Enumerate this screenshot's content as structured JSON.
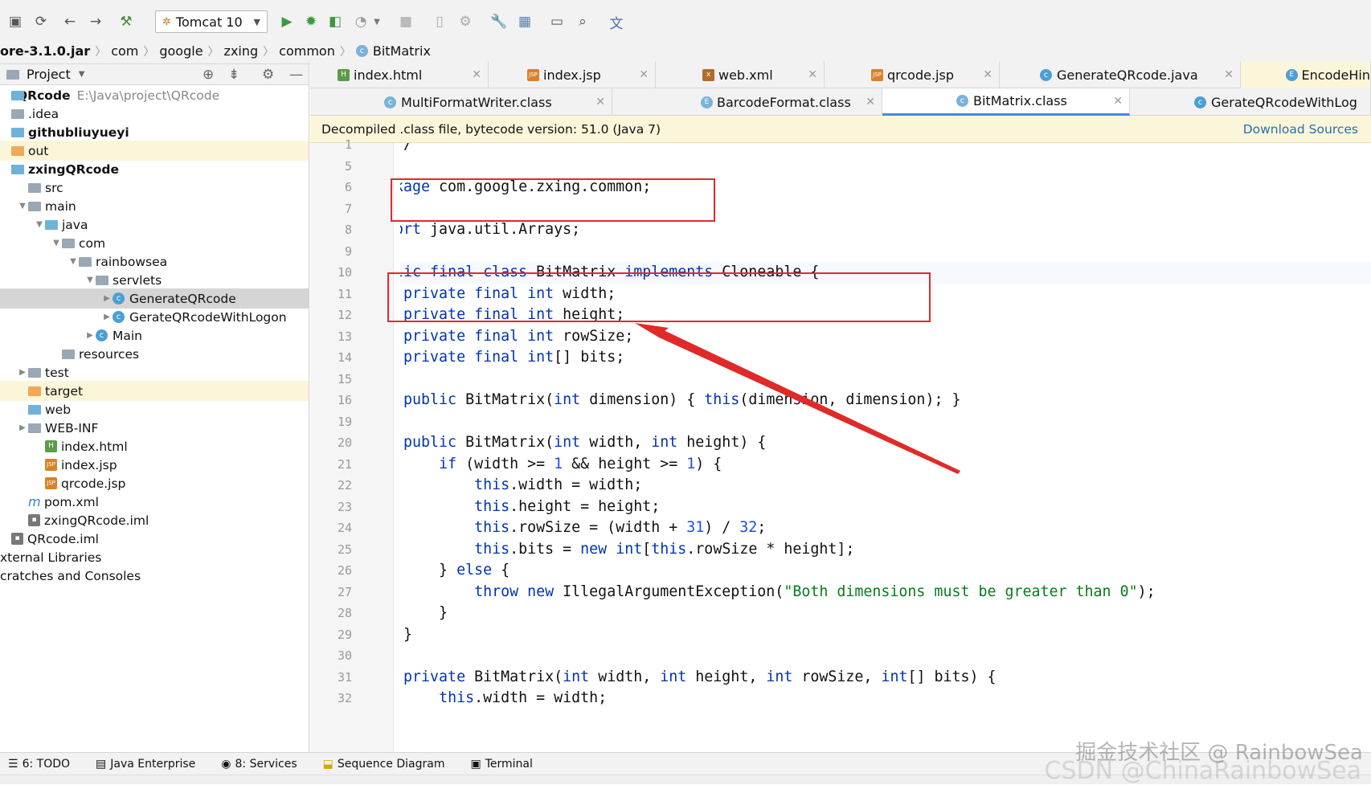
{
  "toolbar": {
    "run_config": "Tomcat 10",
    "icons": [
      "save-icon",
      "sync-icon",
      "back-icon",
      "forward-icon",
      "build-icon",
      "run-icon",
      "debug-icon",
      "coverage-icon",
      "profile-icon",
      "stop-icon",
      "attach-icon",
      "device-icon",
      "wrench-icon",
      "project-structure-icon",
      "terminal-icon",
      "search-icon",
      "translate-icon"
    ]
  },
  "breadcrumb": [
    "ore-3.1.0.jar",
    "com",
    "google",
    "zxing",
    "common",
    "BitMatrix"
  ],
  "project": {
    "header": "Project",
    "tree": [
      {
        "label": "QRcode",
        "extra": "E:\\Java\\project\\QRcode",
        "indent": 0,
        "bold": true,
        "type": "root"
      },
      {
        "label": ".idea",
        "indent": 0,
        "type": "folder"
      },
      {
        "label": "githubliuyueyi",
        "indent": 0,
        "bold": true,
        "type": "module"
      },
      {
        "label": "out",
        "indent": 0,
        "type": "folder-orange",
        "highlight": true
      },
      {
        "label": "zxingQRcode",
        "indent": 0,
        "bold": true,
        "type": "module"
      },
      {
        "label": "src",
        "indent": 1,
        "type": "folder"
      },
      {
        "label": "main",
        "indent": 1,
        "type": "folder",
        "arrow": "down"
      },
      {
        "label": "java",
        "indent": 2,
        "type": "folder-blue",
        "arrow": "down"
      },
      {
        "label": "com",
        "indent": 3,
        "type": "folder",
        "arrow": "down"
      },
      {
        "label": "rainbowsea",
        "indent": 4,
        "type": "folder",
        "arrow": "down"
      },
      {
        "label": "servlets",
        "indent": 5,
        "type": "folder",
        "arrow": "down"
      },
      {
        "label": "GenerateQRcode",
        "indent": 6,
        "type": "class",
        "arrow": "right",
        "selected": true
      },
      {
        "label": "GerateQRcodeWithLogon",
        "indent": 6,
        "type": "class",
        "arrow": "right"
      },
      {
        "label": "Main",
        "indent": 5,
        "type": "class",
        "arrow": "right"
      },
      {
        "label": "resources",
        "indent": 3,
        "type": "folder"
      },
      {
        "label": "test",
        "indent": 1,
        "type": "folder",
        "arrow": "right"
      },
      {
        "label": "target",
        "indent": 1,
        "type": "folder-orange",
        "highlight": true
      },
      {
        "label": "web",
        "indent": 1,
        "type": "folder-blue"
      },
      {
        "label": "WEB-INF",
        "indent": 1,
        "type": "folder",
        "arrow": "right"
      },
      {
        "label": "index.html",
        "indent": 2,
        "type": "html"
      },
      {
        "label": "index.jsp",
        "indent": 2,
        "type": "jsp"
      },
      {
        "label": "qrcode.jsp",
        "indent": 2,
        "type": "jsp"
      },
      {
        "label": "pom.xml",
        "indent": 1,
        "type": "maven"
      },
      {
        "label": "zxingQRcode.iml",
        "indent": 1,
        "type": "iml"
      },
      {
        "label": "QRcode.iml",
        "indent": 0,
        "type": "iml"
      },
      {
        "label": "xternal Libraries",
        "indent": 0,
        "type": "none"
      },
      {
        "label": "cratches and Consoles",
        "indent": 0,
        "type": "none"
      }
    ]
  },
  "tabs_row1": [
    "index.html",
    "index.jsp",
    "web.xml",
    "qrcode.jsp",
    "GenerateQRcode.java",
    "EncodeHin"
  ],
  "tabs_row2": [
    "MultiFormatWriter.class",
    "BarcodeFormat.class",
    "BitMatrix.class",
    "GerateQRcodeWithLog"
  ],
  "active_tab": "BitMatrix.class",
  "banner": {
    "text": "Decompiled .class file, bytecode version: 51.0 (Java 7)",
    "action": "Download Sources"
  },
  "code_lines": [
    {
      "n": "1",
      "t": "/.../"
    },
    {
      "n": "5",
      "t": ""
    },
    {
      "n": "6",
      "t": "package com.google.zxing.common;"
    },
    {
      "n": "7",
      "t": ""
    },
    {
      "n": "8",
      "t": "import java.util.Arrays;"
    },
    {
      "n": "9",
      "t": ""
    },
    {
      "n": "10",
      "t": "public final class BitMatrix implements Cloneable {"
    },
    {
      "n": "11",
      "t": "    private final int width;"
    },
    {
      "n": "12",
      "t": "    private final int height;"
    },
    {
      "n": "13",
      "t": "    private final int rowSize;"
    },
    {
      "n": "14",
      "t": "    private final int[] bits;"
    },
    {
      "n": "15",
      "t": ""
    },
    {
      "n": "16",
      "t": "    public BitMatrix(int dimension) { this(dimension, dimension); }"
    },
    {
      "n": "19",
      "t": ""
    },
    {
      "n": "20",
      "t": "    public BitMatrix(int width, int height) {"
    },
    {
      "n": "21",
      "t": "        if (width >= 1 && height >= 1) {"
    },
    {
      "n": "22",
      "t": "            this.width = width;"
    },
    {
      "n": "23",
      "t": "            this.height = height;"
    },
    {
      "n": "24",
      "t": "            this.rowSize = (width + 31) / 32;"
    },
    {
      "n": "25",
      "t": "            this.bits = new int[this.rowSize * height];"
    },
    {
      "n": "26",
      "t": "        } else {"
    },
    {
      "n": "27",
      "t": "            throw new IllegalArgumentException(\"Both dimensions must be greater than 0\");"
    },
    {
      "n": "28",
      "t": "        }"
    },
    {
      "n": "29",
      "t": "    }"
    },
    {
      "n": "30",
      "t": ""
    },
    {
      "n": "31",
      "t": "    private BitMatrix(int width, int height, int rowSize, int[] bits) {"
    },
    {
      "n": "32",
      "t": "        this.width = width;"
    }
  ],
  "bottom_tools": [
    "6: TODO",
    "Java Enterprise",
    "8: Services",
    "Sequence Diagram",
    "Terminal"
  ],
  "watermark": "掘金技术社区 @ RainbowSea",
  "watermark2": "CSDN @ChinaRainbowSea",
  "colors": {
    "keyword": "#0033b3",
    "string": "#067d17",
    "number": "#1750eb",
    "annotation": "#e02a2a",
    "link": "#2470b3"
  }
}
